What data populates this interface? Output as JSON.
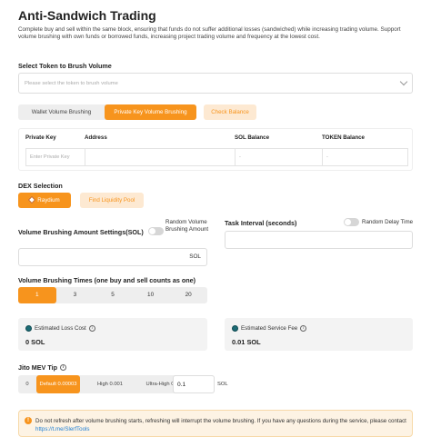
{
  "title": "Anti-Sandwich Trading",
  "description": "Complete buy and sell within the same block, ensuring that funds do not suffer additional losses (sandwiched) while increasing trading volume. Support volume brushing with own funds or borrowed funds, increasing project trading volume and frequency at the lowest cost.",
  "token_select": {
    "label": "Select Token to Brush Volume",
    "placeholder": "Please select the token to brush volume"
  },
  "tabs": [
    {
      "label": "Wallet Volume Brushing",
      "active": false
    },
    {
      "label": "Private Key Volume Brushing",
      "active": true
    }
  ],
  "check_balance_label": "Check Balance",
  "key_table": {
    "headers": [
      "Private Key",
      "Address",
      "SOL Balance",
      "TOKEN Balance"
    ],
    "row": {
      "private_key_placeholder": "Enter Private Key",
      "address": "",
      "sol_balance": "-",
      "token_balance": "-"
    }
  },
  "dex": {
    "label": "DEX Selection",
    "selected": "Raydium",
    "find_pool_label": "Find Liquidity Pool"
  },
  "amount": {
    "label": "Volume Brushing Amount Settings(SOL)",
    "random_label": "Random Volume Brushing Amount",
    "unit": "SOL",
    "value": ""
  },
  "interval": {
    "label": "Task Interval (seconds)",
    "random_label": "Random Delay Time",
    "value": ""
  },
  "times": {
    "label": "Volume Brushing Times (one buy and sell counts as one)",
    "options": [
      "1",
      "3",
      "5",
      "10",
      "20"
    ],
    "selected": "1"
  },
  "loss_cost": {
    "label": "Estimated Loss Cost",
    "value": "0 SOL"
  },
  "service_fee": {
    "label": "Estimated Service Fee",
    "value": "0.01 SOL"
  },
  "mev": {
    "label": "Jito MEV Tip",
    "options": [
      "0",
      "Default 0.00003",
      "High 0.001",
      "Ultra-High 0.01"
    ],
    "selected": "Default 0.00003",
    "value": "0.1",
    "unit": "SOL"
  },
  "notice": {
    "text": "Do not refresh after volume brushing starts, refreshing will interrupt the volume brushing. If you have any questions during the service, please contact",
    "link": "https://t.me/SlerfTools"
  },
  "colors": {
    "accent": "#f7941d",
    "accent_light": "#fde9d2",
    "notice_bg": "#fdf3e4",
    "link": "#1e7fd6"
  }
}
